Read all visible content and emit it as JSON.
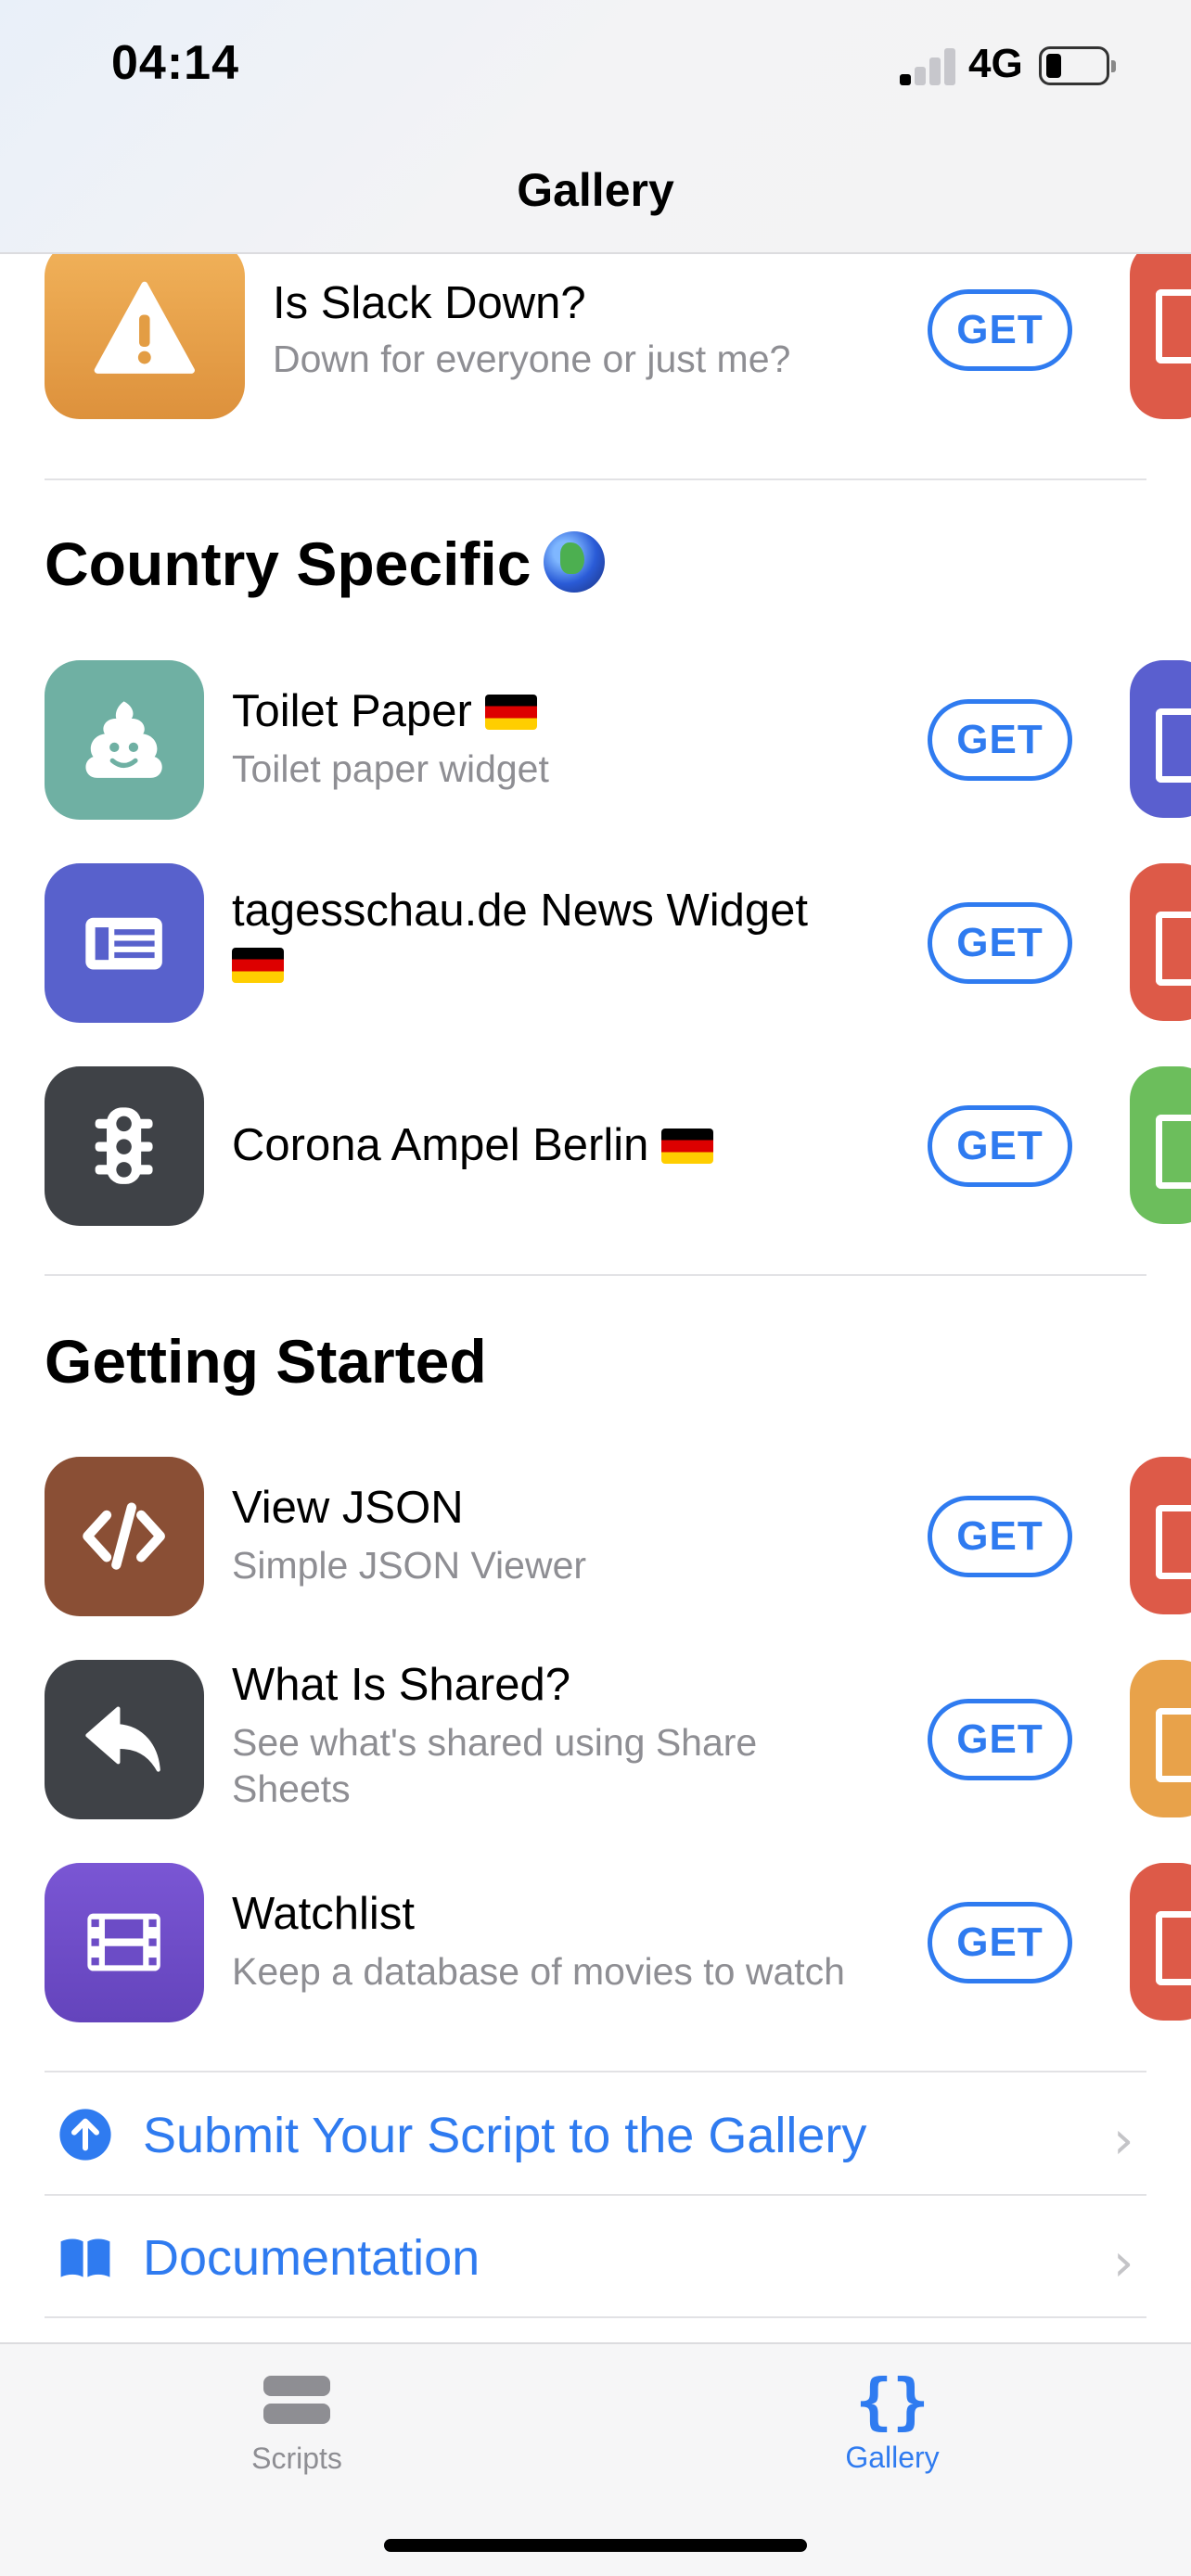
{
  "status_bar": {
    "time": "04:14",
    "network": "4G"
  },
  "nav": {
    "title": "Gallery"
  },
  "partial_item": {
    "title": "Is Slack Down?",
    "subtitle": "Down for everyone or just me?",
    "get": "GET",
    "icon": "warning-icon"
  },
  "sections": [
    {
      "title": "Country Specific",
      "emoji": "globe-emoji",
      "items": [
        {
          "title": "Toilet Paper",
          "subtitle": "Toilet paper widget",
          "get": "GET",
          "icon": "poop-icon",
          "flag": "germany-flag"
        },
        {
          "title": "tagesschau.de News Widget",
          "subtitle": "",
          "get": "GET",
          "icon": "newspaper-icon",
          "flag": "germany-flag"
        },
        {
          "title": "Corona Ampel Berlin",
          "subtitle": "",
          "get": "GET",
          "icon": "traffic-light-icon",
          "flag": "germany-flag"
        }
      ]
    },
    {
      "title": "Getting Started",
      "items": [
        {
          "title": "View JSON",
          "subtitle": "Simple JSON Viewer",
          "get": "GET",
          "icon": "code-icon"
        },
        {
          "title": "What Is Shared?",
          "subtitle": "See what's shared using Share Sheets",
          "get": "GET",
          "icon": "reply-arrow-icon"
        },
        {
          "title": "Watchlist",
          "subtitle": "Keep a database of movies to watch",
          "get": "GET",
          "icon": "film-icon"
        }
      ]
    }
  ],
  "links": [
    {
      "label": "Submit Your Script to the Gallery",
      "icon": "upload-arrow-icon"
    },
    {
      "label": "Documentation",
      "icon": "book-icon"
    }
  ],
  "tabbar": {
    "tabs": [
      {
        "label": "Scripts",
        "icon": "stack-icon",
        "selected": false
      },
      {
        "label": "Gallery",
        "icon": "braces-icon",
        "selected": true
      }
    ]
  },
  "colors": {
    "accent": "#2f7bf0",
    "icon_orange": "#e8a24a",
    "icon_teal": "#6fb0a3",
    "icon_indigo": "#5861cc",
    "icon_dark": "#3f4247",
    "icon_brown": "#8a4f35",
    "icon_purple": "#7050c8"
  }
}
